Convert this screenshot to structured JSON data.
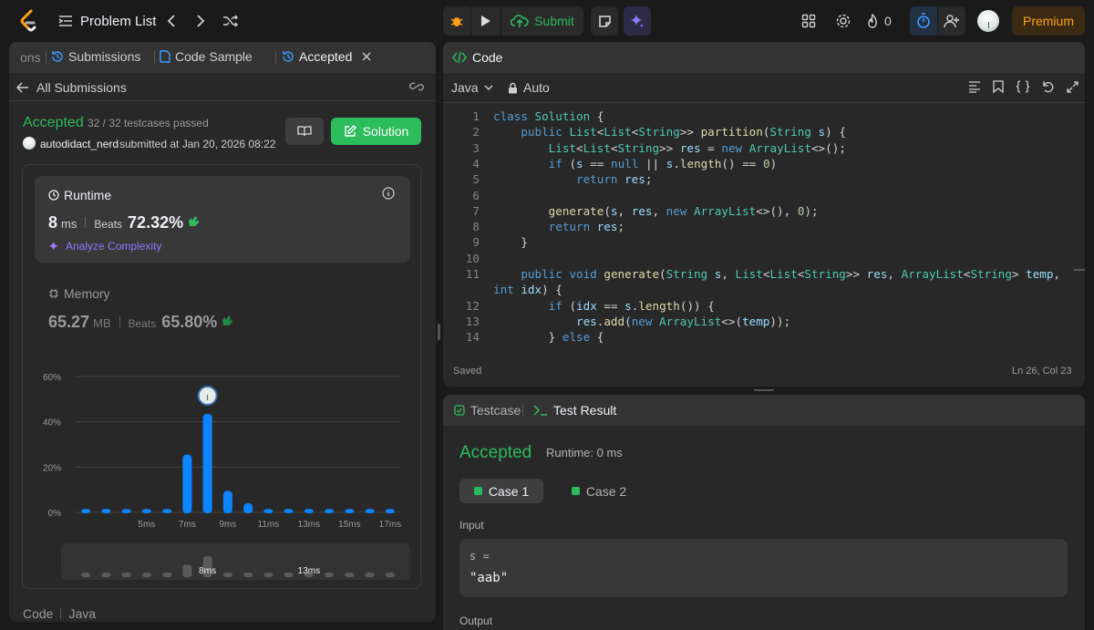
{
  "topbar": {
    "problem_list": "Problem List",
    "submit": "Submit",
    "streak_count": "0",
    "premium": "Premium"
  },
  "left": {
    "tabs": [
      {
        "label": "ons"
      },
      {
        "label": "Submissions"
      },
      {
        "label": "Code Sample"
      },
      {
        "label": "Accepted"
      }
    ],
    "back_label": "All Submissions",
    "status": "Accepted",
    "testcases": "32 / 32 testcases passed",
    "username": "autodidact_nerd",
    "submitted_at": "submitted at Jan 20, 2026 08:22",
    "solution_button": "Solution",
    "runtime": {
      "title": "Runtime",
      "value": "8",
      "unit": "ms",
      "beats_label": "Beats",
      "beats_value": "72.32%",
      "analyze": "Analyze Complexity"
    },
    "memory": {
      "title": "Memory",
      "value": "65.27",
      "unit": "MB",
      "beats_label": "Beats",
      "beats_value": "65.80%"
    },
    "footer": {
      "code": "Code",
      "lang": "Java"
    }
  },
  "chart_data": {
    "type": "bar",
    "y_ticks": [
      "60%",
      "40%",
      "20%",
      "0%"
    ],
    "ylim": [
      0,
      60
    ],
    "x_tick_labels": [
      "5ms",
      "7ms",
      "9ms",
      "11ms",
      "13ms",
      "15ms",
      "17ms"
    ],
    "categories": [
      "2ms",
      "3ms",
      "4ms",
      "5ms",
      "6ms",
      "7ms",
      "8ms",
      "9ms",
      "10ms",
      "11ms",
      "12ms",
      "13ms",
      "14ms",
      "15ms",
      "16ms",
      "17ms"
    ],
    "values": [
      1.5,
      1.5,
      1.5,
      1.5,
      1.5,
      25.5,
      43.5,
      9.5,
      4,
      1.5,
      1.5,
      1.5,
      1.5,
      1.5,
      1.5,
      1.5
    ],
    "highlight_index": 6,
    "mini_labels": [
      "8ms",
      "13ms"
    ],
    "grid": true,
    "bar_color": "#0a84ff"
  },
  "editor": {
    "title": "Code",
    "language": "Java",
    "mode": "Auto",
    "status": "Saved",
    "cursor": "Ln 26, Col 23",
    "lines": [
      {
        "n": "1",
        "text": "class Solution {"
      },
      {
        "n": "2",
        "text": "    public List<List<String>> partition(String s) {"
      },
      {
        "n": "3",
        "text": "        List<List<String>> res = new ArrayList<>();"
      },
      {
        "n": "4",
        "text": "        if (s == null || s.length() == 0)"
      },
      {
        "n": "5",
        "text": "            return res;"
      },
      {
        "n": "6",
        "text": ""
      },
      {
        "n": "7",
        "text": "        generate(s, res, new ArrayList<>(), 0);"
      },
      {
        "n": "8",
        "text": "        return res;"
      },
      {
        "n": "9",
        "text": "    }"
      },
      {
        "n": "10",
        "text": ""
      },
      {
        "n": "11",
        "text": "    public void generate(String s, List<List<String>> res, ArrayList<String> temp,"
      },
      {
        "n": "",
        "text": "int idx) {"
      },
      {
        "n": "12",
        "text": "        if (idx == s.length()) {"
      },
      {
        "n": "13",
        "text": "            res.add(new ArrayList<>(temp));"
      },
      {
        "n": "14",
        "text": "        } else {"
      }
    ]
  },
  "testpanel": {
    "tab_testcase": "Testcase",
    "tab_result": "Test Result",
    "status": "Accepted",
    "runtime": "Runtime: 0 ms",
    "case1": "Case 1",
    "case2": "Case 2",
    "input_label": "Input",
    "var_name": "s =",
    "var_value": "\"aab\"",
    "output_label": "Output"
  }
}
